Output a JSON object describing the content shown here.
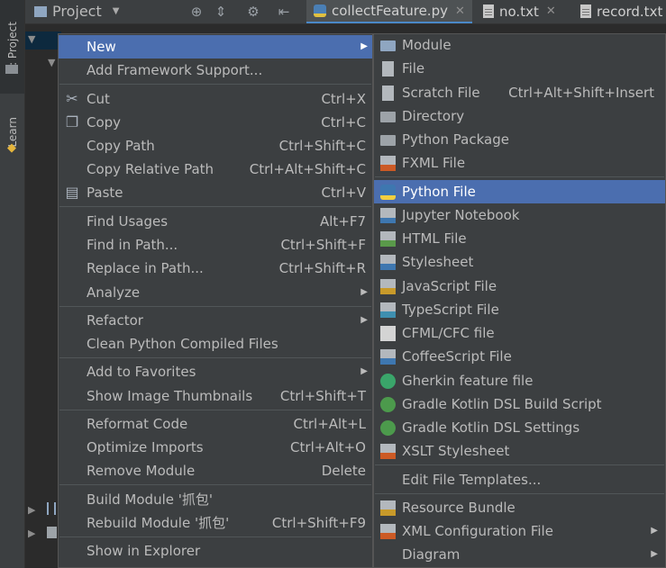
{
  "left_strip": {
    "project_tab": "1: Project",
    "learn_tab": "Learn"
  },
  "toolbar": {
    "project_label": "Project"
  },
  "tabs": [
    {
      "label": "collectFeature.py",
      "active": true
    },
    {
      "label": "no.txt",
      "active": false
    },
    {
      "label": "record.txt",
      "active": false
    }
  ],
  "context_menu": {
    "new": "New",
    "add_framework_support": "Add Framework Support...",
    "cut": "Cut",
    "cut_sc": "Ctrl+X",
    "copy": "Copy",
    "copy_sc": "Ctrl+C",
    "copy_path": "Copy Path",
    "copy_path_sc": "Ctrl+Shift+C",
    "copy_relative_path": "Copy Relative Path",
    "copy_relative_path_sc": "Ctrl+Alt+Shift+C",
    "paste": "Paste",
    "paste_sc": "Ctrl+V",
    "find_usages": "Find Usages",
    "find_usages_sc": "Alt+F7",
    "find_in_path": "Find in Path...",
    "find_in_path_sc": "Ctrl+Shift+F",
    "replace_in_path": "Replace in Path...",
    "replace_in_path_sc": "Ctrl+Shift+R",
    "analyze": "Analyze",
    "refactor": "Refactor",
    "clean_compiled": "Clean Python Compiled Files",
    "add_to_favorites": "Add to Favorites",
    "show_thumbnails": "Show Image Thumbnails",
    "show_thumbnails_sc": "Ctrl+Shift+T",
    "reformat_code": "Reformat Code",
    "reformat_code_sc": "Ctrl+Alt+L",
    "optimize_imports": "Optimize Imports",
    "optimize_imports_sc": "Ctrl+Alt+O",
    "remove_module": "Remove Module",
    "remove_module_sc": "Delete",
    "build_module": "Build Module '抓包'",
    "rebuild_module": "Rebuild Module '抓包'",
    "rebuild_module_sc": "Ctrl+Shift+F9",
    "show_in_explorer": "Show in Explorer"
  },
  "submenu": {
    "module": "Module",
    "file": "File",
    "scratch_file": "Scratch File",
    "scratch_file_sc": "Ctrl+Alt+Shift+Insert",
    "directory": "Directory",
    "python_package": "Python Package",
    "fxml_file": "FXML File",
    "python_file": "Python File",
    "jupyter_notebook": "Jupyter Notebook",
    "html_file": "HTML File",
    "stylesheet": "Stylesheet",
    "javascript_file": "JavaScript File",
    "typescript_file": "TypeScript File",
    "cfml_file": "CFML/CFC file",
    "coffeescript_file": "CoffeeScript File",
    "gherkin_file": "Gherkin feature file",
    "gradle_build_script": "Gradle Kotlin DSL Build Script",
    "gradle_settings": "Gradle Kotlin DSL Settings",
    "xslt_stylesheet": "XSLT Stylesheet",
    "edit_file_templates": "Edit File Templates...",
    "resource_bundle": "Resource Bundle",
    "xml_config_file": "XML Configuration File",
    "diagram": "Diagram"
  },
  "colors": {
    "selection": "#4b6eaf",
    "menu_bg": "#3c3f41",
    "editor_bg": "#2b2b2b"
  }
}
